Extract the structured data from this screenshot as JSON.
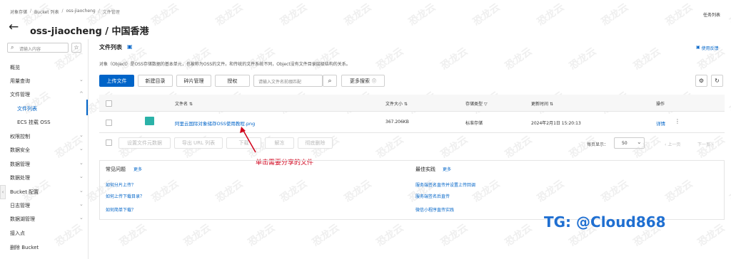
{
  "breadcrumb": [
    "对象存储",
    "Bucket 列表",
    "oss-jiaocheng",
    "文件管理"
  ],
  "breadcrumb_sep": "/",
  "task_list": "任务列表",
  "page_title": "oss-jiaocheng / 中国香港",
  "search": {
    "placeholder": "请输入内容"
  },
  "sidebar": {
    "items": [
      {
        "label": "概览"
      },
      {
        "label": "用量查询"
      },
      {
        "label": "文件管理"
      },
      {
        "label": "文件列表"
      },
      {
        "label": "ECS 挂载 OSS"
      },
      {
        "label": "权限控制"
      },
      {
        "label": "数据安全"
      },
      {
        "label": "数据管理"
      },
      {
        "label": "数据处理"
      },
      {
        "label": "Bucket 配置"
      },
      {
        "label": "日志管理"
      },
      {
        "label": "数据湖管理"
      },
      {
        "label": "接入点"
      },
      {
        "label": "删除 Bucket"
      }
    ]
  },
  "section_title": "文件列表",
  "help_link": "使用反馈",
  "description": "对象（Object）是OSS存储数据的基本单元，也被称为OSS的文件。和传统的文件系统不同，Object没有文件目录层级结构的关系。",
  "toolbar": {
    "upload": "上传文件",
    "new_dir": "新建目录",
    "fragment": "碎片管理",
    "authorize": "授权",
    "file_search_placeholder": "请输入文件名前缀匹配",
    "more_search": "更多搜索"
  },
  "table": {
    "headers": {
      "name": "文件名",
      "size": "文件大小",
      "storage": "存储类型",
      "updated": "更新时间",
      "actions": "操作"
    },
    "rows": [
      {
        "name": "阿里云国际对象储存OSS使用教程.png",
        "size": "367.206KB",
        "storage": "标准存储",
        "updated": "2024年2月1日 15:20:13",
        "detail": "详情"
      }
    ]
  },
  "bulk": {
    "set_meta": "设置文件元数据",
    "export_url": "导出 URL 列表",
    "download": "下载",
    "unfreeze": "解冻",
    "delete": "彻底删除"
  },
  "pagination": {
    "per_page_label": "每页显示：",
    "per_page_value": "50",
    "prev": "上一页",
    "next": "下一页"
  },
  "annotation": "单击需要分享的文件",
  "faq": {
    "title": "常见问题",
    "more": "更多",
    "items": [
      "如何分片上传？",
      "如何上传下载目录？",
      "如何简单下载？"
    ]
  },
  "best": {
    "title": "最佳实践",
    "more": "更多",
    "items": [
      "服务端签名直传并设置上传回调",
      "服务端签名后直传",
      "微信小程序直传实践"
    ]
  },
  "watermark": "恐龙云",
  "tg_label": "TG: @Cloud868",
  "colors": {
    "accent": "#0064c8",
    "annotation": "#d0021b",
    "tg": "#1f6fd1"
  }
}
